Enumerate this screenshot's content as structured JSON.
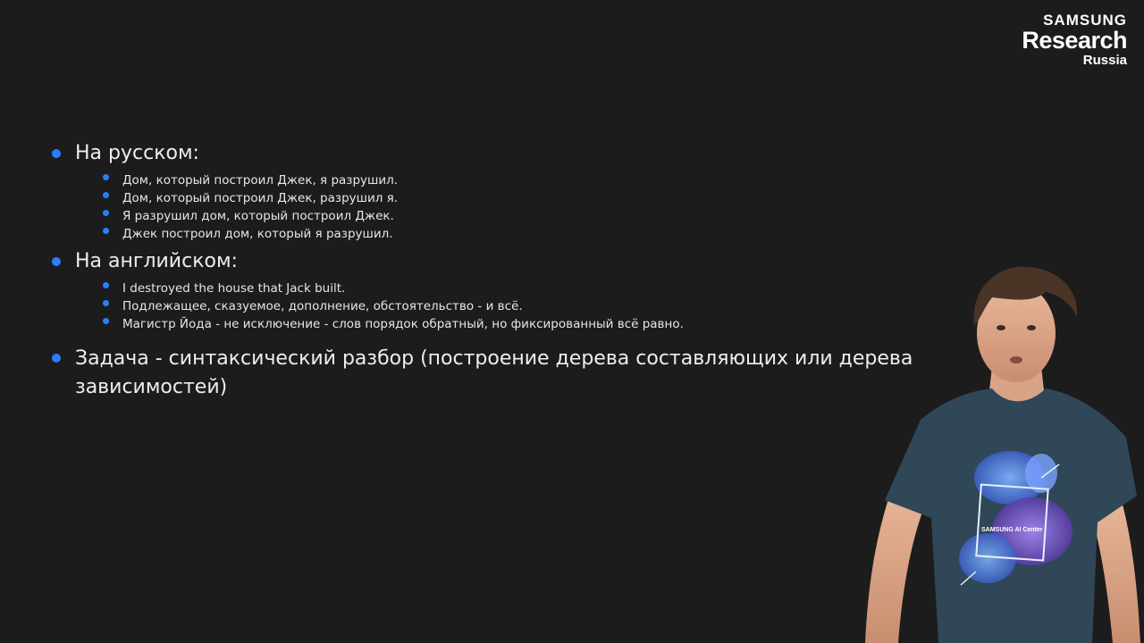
{
  "logo": {
    "line1": "SAMSUNG",
    "line2": "Research",
    "line3": "Russia"
  },
  "sections": [
    {
      "heading": "На русском:",
      "items": [
        "Дом, который построил Джек, я разрушил.",
        "Дом, который построил Джек, разрушил я.",
        "Я разрушил дом, который построил Джек.",
        "Джек построил дом, который я разрушил."
      ]
    },
    {
      "heading": "На английском:",
      "items": [
        "I destroyed the house that Jack built.",
        "Подлежащее, сказуемое, дополнение, обстоятельство - и всё.",
        "Магистр Йода - не исключение - слов порядок обратный, но фиксированный всё равно."
      ]
    }
  ],
  "task": "Задача - синтаксический разбор (построение дерева составляющих или дерева зависимостей)",
  "tshirt_print": "SAMSUNG AI Center",
  "colors": {
    "background": "#1c1c1c",
    "bullet": "#2a7fff",
    "text": "#eeeeee"
  }
}
